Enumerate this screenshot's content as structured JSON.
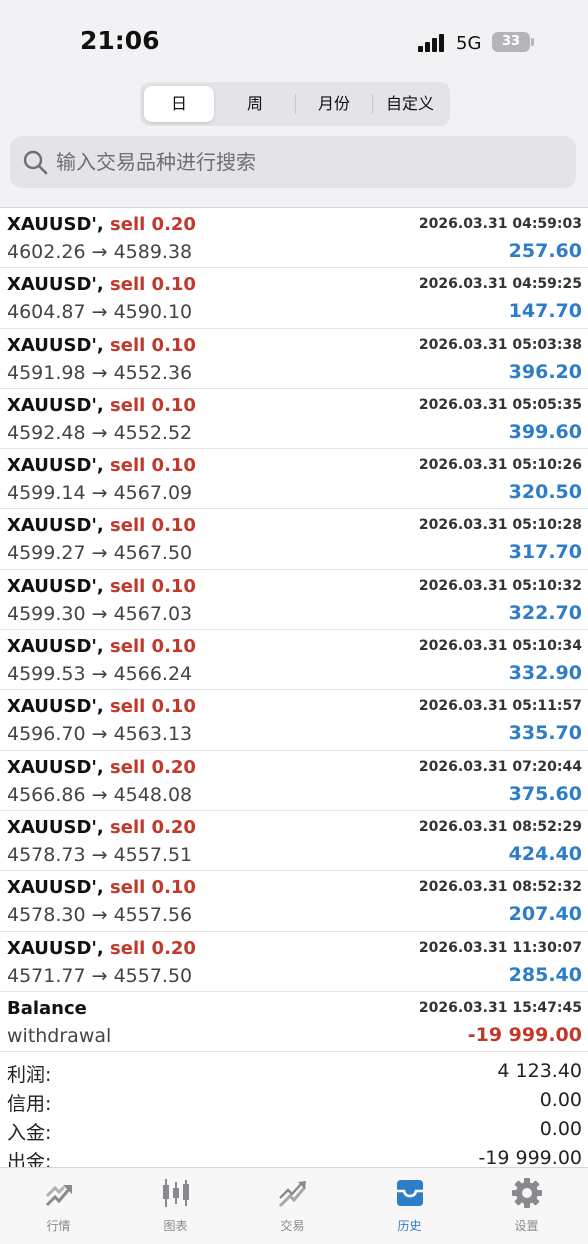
{
  "status_bar": {
    "time": "21:06",
    "network": "5G",
    "battery": "33"
  },
  "period_tabs": [
    "日",
    "周",
    "月份",
    "自定义"
  ],
  "search": {
    "placeholder": "输入交易品种进行搜索"
  },
  "deals": [
    {
      "symbol": "XAUUSD'",
      "side": "sell 0.20",
      "time": "2026.03.31 04:59:03",
      "prices": "4602.26 → 4589.38",
      "profit": "257.60"
    },
    {
      "symbol": "XAUUSD'",
      "side": "sell 0.10",
      "time": "2026.03.31 04:59:25",
      "prices": "4604.87 → 4590.10",
      "profit": "147.70"
    },
    {
      "symbol": "XAUUSD'",
      "side": "sell 0.10",
      "time": "2026.03.31 05:03:38",
      "prices": "4591.98 → 4552.36",
      "profit": "396.20"
    },
    {
      "symbol": "XAUUSD'",
      "side": "sell 0.10",
      "time": "2026.03.31 05:05:35",
      "prices": "4592.48 → 4552.52",
      "profit": "399.60"
    },
    {
      "symbol": "XAUUSD'",
      "side": "sell 0.10",
      "time": "2026.03.31 05:10:26",
      "prices": "4599.14 → 4567.09",
      "profit": "320.50"
    },
    {
      "symbol": "XAUUSD'",
      "side": "sell 0.10",
      "time": "2026.03.31 05:10:28",
      "prices": "4599.27 → 4567.50",
      "profit": "317.70"
    },
    {
      "symbol": "XAUUSD'",
      "side": "sell 0.10",
      "time": "2026.03.31 05:10:32",
      "prices": "4599.30 → 4567.03",
      "profit": "322.70"
    },
    {
      "symbol": "XAUUSD'",
      "side": "sell 0.10",
      "time": "2026.03.31 05:10:34",
      "prices": "4599.53 → 4566.24",
      "profit": "332.90"
    },
    {
      "symbol": "XAUUSD'",
      "side": "sell 0.10",
      "time": "2026.03.31 05:11:57",
      "prices": "4596.70 → 4563.13",
      "profit": "335.70"
    },
    {
      "symbol": "XAUUSD'",
      "side": "sell 0.20",
      "time": "2026.03.31 07:20:44",
      "prices": "4566.86 → 4548.08",
      "profit": "375.60"
    },
    {
      "symbol": "XAUUSD'",
      "side": "sell 0.20",
      "time": "2026.03.31 08:52:29",
      "prices": "4578.73 → 4557.51",
      "profit": "424.40"
    },
    {
      "symbol": "XAUUSD'",
      "side": "sell 0.10",
      "time": "2026.03.31 08:52:32",
      "prices": "4578.30 → 4557.56",
      "profit": "207.40"
    },
    {
      "symbol": "XAUUSD'",
      "side": "sell 0.20",
      "time": "2026.03.31 11:30:07",
      "prices": "4571.77 → 4557.50",
      "profit": "285.40"
    }
  ],
  "balance_entry": {
    "title": "Balance",
    "time": "2026.03.31 15:47:45",
    "description": "withdrawal",
    "amount": "-19 999.00"
  },
  "summary": [
    {
      "label": "利润:",
      "value": "4 123.40"
    },
    {
      "label": "信用:",
      "value": "0.00"
    },
    {
      "label": "入金:",
      "value": "0.00"
    },
    {
      "label": "出金:",
      "value": "-19 999.00"
    }
  ],
  "tabbar": [
    {
      "label": "行情",
      "icon": "quotes-icon"
    },
    {
      "label": "图表",
      "icon": "chart-icon"
    },
    {
      "label": "交易",
      "icon": "trade-icon"
    },
    {
      "label": "历史",
      "icon": "history-icon",
      "active": true
    },
    {
      "label": "设置",
      "icon": "settings-icon"
    }
  ],
  "colors": {
    "profit": "#2e7dc9",
    "loss": "#c0392b",
    "active_tab": "#2e7dc9",
    "inactive_tab": "#8a8a8e"
  }
}
